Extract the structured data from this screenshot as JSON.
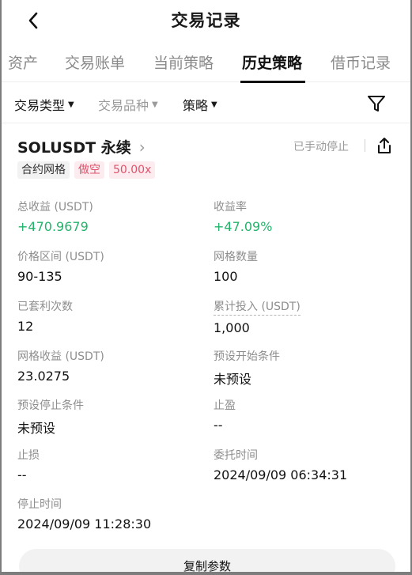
{
  "header": {
    "title": "交易记录"
  },
  "tabs": [
    {
      "label": "资产"
    },
    {
      "label": "交易账单"
    },
    {
      "label": "当前策略"
    },
    {
      "label": "历史策略"
    },
    {
      "label": "借币记录"
    }
  ],
  "active_tab": "历史策略",
  "filters": {
    "type_label": "交易类型",
    "product_label": "交易品种",
    "strategy_label": "策略"
  },
  "card": {
    "symbol": "SOLUSDT 永续",
    "status": "已手动停止",
    "tags": [
      "合约网格",
      "做空",
      "50.00x"
    ],
    "stats": [
      {
        "label": "总收益 (USDT)",
        "value": "+470.9679"
      },
      {
        "label": "收益率",
        "value": "+47.09%"
      },
      {
        "label": "价格区间 (USDT)",
        "value": "90-135"
      },
      {
        "label": "网格数量",
        "value": "100"
      },
      {
        "label": "已套利次数",
        "value": "12"
      },
      {
        "label": "累计投入 (USDT)",
        "value": "1,000"
      },
      {
        "label": "网格收益 (USDT)",
        "value": "23.0275"
      },
      {
        "label": "预设开始条件",
        "value": "未预设"
      },
      {
        "label": "预设停止条件",
        "value": "未预设"
      },
      {
        "label": "止盈",
        "value": "--"
      },
      {
        "label": "止损",
        "value": "--"
      },
      {
        "label": "委托时间",
        "value": "2024/09/09 06:34:31"
      },
      {
        "label": "停止时间",
        "value": "2024/09/09 11:28:30"
      }
    ],
    "copy_button": "复制参数"
  },
  "colors": {
    "positive": "#24b36b",
    "short_tag": "#e0526b",
    "muted": "#8e8e8e"
  },
  "icons": [
    "back-arrow-icon",
    "caret-down-icon",
    "filter-funnel-icon",
    "chevron-right-icon",
    "share-icon"
  ]
}
